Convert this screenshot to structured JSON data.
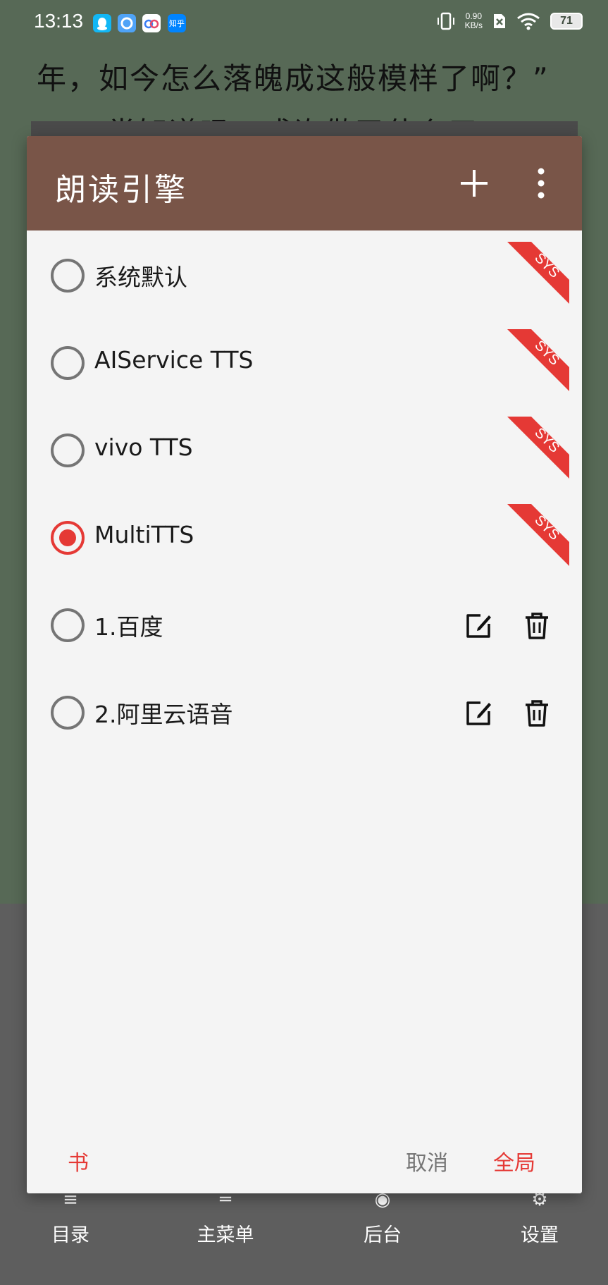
{
  "status_bar": {
    "time": "13:13",
    "apps": [
      "qq-icon",
      "browser-icon",
      "baidu-netdisk-icon",
      "zhihu-icon"
    ],
    "zhihu_label": "知乎",
    "net_speed_value": "0.90",
    "net_speed_unit": "KB/s",
    "battery": "71"
  },
  "reader": {
    "line1": "年，如今怎么落魄成这般模样了啊？”",
    "line2": "“尝知道吗，或许做了什么三..."
  },
  "dialog": {
    "title": "朗读引擎",
    "engines": [
      {
        "label": "系统默认",
        "checked": false,
        "sys": true
      },
      {
        "label": "AIService TTS",
        "checked": false,
        "sys": true
      },
      {
        "label": "vivo TTS",
        "checked": false,
        "sys": true
      },
      {
        "label": "MultiTTS",
        "checked": true,
        "sys": true
      },
      {
        "label": "1.百度",
        "checked": false,
        "sys": false
      },
      {
        "label": "2.阿里云语音",
        "checked": false,
        "sys": false
      }
    ],
    "sys_badge_text": "SYS",
    "footer": {
      "book": "书",
      "cancel": "取消",
      "global": "全局"
    }
  },
  "bottom_menu": {
    "items": [
      "目录",
      "主菜单",
      "后台",
      "设置"
    ]
  },
  "colors": {
    "header": "#795548",
    "accent": "#e53935",
    "reader_bg": "#576956"
  }
}
